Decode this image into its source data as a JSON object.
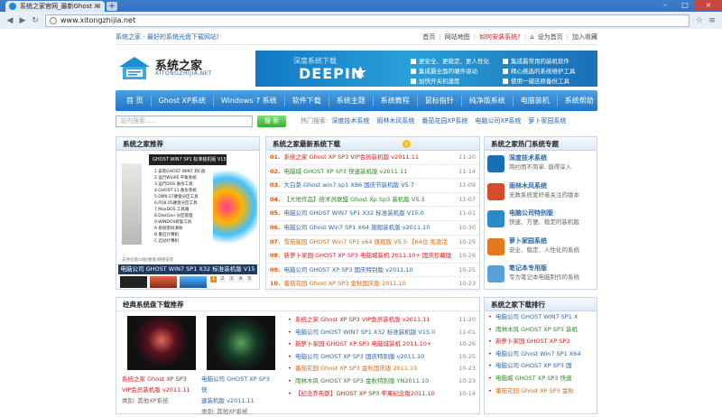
{
  "browser": {
    "tab_title": "系统之家官网_最新Ghost XI",
    "tab_close": "×",
    "new_tab": "+",
    "url": "www.xitongzhijia.net",
    "win_min": "–",
    "win_max": "□",
    "win_close": "×",
    "back": "◀",
    "forward": "▶",
    "reload": "↻",
    "star": "☆",
    "menu": "≡"
  },
  "topline": {
    "slogan": "系统之家 - 最好的系统光盘下载网站!",
    "links": [
      {
        "label": "首页",
        "hot": false
      },
      {
        "label": "网站地图",
        "hot": false
      },
      {
        "label": "如何安装系统?",
        "hot": true
      },
      {
        "label": "设为首页",
        "hot": false
      },
      {
        "label": "加入收藏",
        "hot": false
      }
    ]
  },
  "logo": {
    "title": "系统之家",
    "sub": "XITONGZHIJIA.NET"
  },
  "banner": {
    "line1": "深度系统下载",
    "brand": "DEEPIN",
    "features": [
      "更安全、更稳定、更人性化",
      "集成最常用的装机软件",
      "集成最全面的硬件驱动",
      "精心挑选的系统维护工具",
      "加快开关机速度",
      "使用一键还原备份工具"
    ]
  },
  "menu": [
    "首 页",
    "Ghost XP系统",
    "Windows 7 系统",
    "软件下载",
    "系统主题",
    "系统教程",
    "鼠标指针",
    "纯净版系统",
    "电脑装机",
    "系统帮助"
  ],
  "search": {
    "placeholder": "站内搜索......",
    "button": "搜 索",
    "hot_label": "热门搜索:",
    "hot_keys": [
      "深度技术系统",
      "雨林木风系统",
      "番茄花园XP系统",
      "电脑公司XP系统",
      "萝卜家园系统"
    ]
  },
  "recommend": {
    "title": "系统之家推荐",
    "dvd_label": "GHOST WIN7 SP1 标准装机版 V15",
    "menu_items": [
      "1.安装GHOST WIN7 到C盘",
      "2.运行WinPE 平板系统",
      "3.运行DOS 备份工具",
      "4.GHOST 11 备份系统",
      "5.DM9.57硬盘分区工具",
      "6.PQ8.05硬盘分区工具",
      "7.MaxDOS 工具箱",
      "8.DiskGen 分区管理",
      "9.WINDOS修复工具",
      "A.系统密码清除",
      "B.重启计算机",
      "C.启动计算机"
    ],
    "caption": "支持光盘/U盘/硬盘/网络安装",
    "footer_title": "电脑公司 GHOST WIN7 SP1 X32 标准装机版 V15",
    "pages": [
      "1",
      "2",
      "3",
      "4",
      "5"
    ],
    "thumb_colors": [
      "#222222",
      "#c44d2a",
      "#3a8ad0",
      "#2a9a5e",
      "#e6c23a"
    ]
  },
  "downloads": {
    "title": "系统之家最新系统下载",
    "items": [
      {
        "num": "01.",
        "title": "系统之家 Ghost XP SP3 VIP会员装机版 v2011.11",
        "date": "11-20",
        "color": "red"
      },
      {
        "num": "02.",
        "title": "电脑城 GHOST XP SP3 快速装机版 v2011.11",
        "date": "11-14",
        "color": "green"
      },
      {
        "num": "03.",
        "title": "大白菜 Ghost win7 sp1 X86 国庆节装机版 V5.7",
        "date": "11-09",
        "color": "blue"
      },
      {
        "num": "04.",
        "title": "【大地作品】技术员联盟 Ghost Xp Sp3 装机版 V5.3",
        "date": "11-07",
        "color": "green"
      },
      {
        "num": "05.",
        "title": "电脑公司 GHOST WIN7 SP1 X32 标准装机版 V15.0",
        "date": "11-01",
        "color": "blue"
      },
      {
        "num": "06.",
        "title": "电脑公司 Ghost Win7 SP1 X64 旗舰装机版 v2011.10",
        "date": "10-30",
        "color": "blue"
      },
      {
        "num": "07.",
        "title": "雪茄家园 GHOST Win7 SP1 x64 旗舰版 V5.5 【64位 免激活",
        "date": "10-29",
        "color": "orange"
      },
      {
        "num": "08.",
        "title": "新萝卜家园 GHOST XP SP3 电脑城装机 2011.10+ 国庆珍藏版",
        "date": "10-26",
        "color": "red"
      },
      {
        "num": "09.",
        "title": "电脑公司 GHOST XP SP3 国庆特别版 v2011.10",
        "date": "10-25",
        "color": "blue"
      },
      {
        "num": "10.",
        "title": "番茄花园 Ghost XP SP3 金秋国庆版 2011.10",
        "date": "10-23",
        "color": "orange"
      }
    ]
  },
  "hot_topics": {
    "title": "系统之家热门系统专题",
    "items": [
      {
        "title": "深度技术系统",
        "desc": "简约而不简单, 值得深入",
        "color": "#1a6fb3"
      },
      {
        "title": "雨林木风系统",
        "desc": "无数系统爱好者关注的版本",
        "color": "#d94a2a"
      },
      {
        "title": "电脑公司特别版",
        "desc": "快速、方便、稳定的装机版",
        "color": "#2a8acb"
      },
      {
        "title": "萝卜家园系统",
        "desc": "安全、稳定、人性化的系统",
        "color": "#e47a1e"
      },
      {
        "title": "笔记本专用版",
        "desc": "专为笔记本电脑制作的系统",
        "color": "#5aa0d8"
      }
    ]
  },
  "classic": {
    "title": "经典系统盘下载推荐",
    "cards": [
      {
        "line1": "系统之家 Ghost XP SP3",
        "line2": "VIP会员装机版 v2011.11",
        "line3": "类别: 其他XP系统",
        "red": true
      },
      {
        "line1": "电脑公司 GHOST XP SP3 快",
        "line2": "速装机版 v2011.11",
        "line3": "类别: 其他XP系统",
        "red": false
      }
    ],
    "items": [
      {
        "title": "系统之家 Ghost XP SP3 VIP会员装机版 v2011.11",
        "date": "11-20",
        "color": "red"
      },
      {
        "title": "电脑公司 GHOST WIN7 SP1 X32 标准装机版 V15.0",
        "date": "11-01",
        "color": "blue"
      },
      {
        "title": "新萝卜家园 GHOST XP SP3 电脑城装机 2011.10+",
        "date": "10-26",
        "color": "red"
      },
      {
        "title": "电脑公司 GHOST XP SP3 国庆特别版 v2011.10",
        "date": "10-25",
        "color": "blue"
      },
      {
        "title": "番茄花园 Ghost XP SP3 金秋国庆版 2011.10",
        "date": "10-23",
        "color": "orange"
      },
      {
        "title": "雨林木风 GHOST XP SP3 金秋特别版 YN2011.10",
        "date": "10-23",
        "color": "green"
      },
      {
        "title": "【纪念乔布斯】GHOST XP SP3 苹果纪念版2011.10",
        "date": "10-14",
        "color": "red"
      }
    ]
  },
  "rank": {
    "title": "系统之家下载排行",
    "items": [
      {
        "title": "电脑公司 GHOST WIN7 SP1 X",
        "color": "blue"
      },
      {
        "title": "雨林木风 GHOST XP SP3 装机",
        "color": "green"
      },
      {
        "title": "新萝卜家园 GHOST XP SP3",
        "color": "red"
      },
      {
        "title": "电脑公司 Ghost Win7 SP1 X64",
        "color": "blue"
      },
      {
        "title": "电脑公司 GHOST XP SP3 国",
        "color": "blue"
      },
      {
        "title": "电脑城 GHOST XP SP3 快速",
        "color": "green"
      },
      {
        "title": "番茄花园 Ghost XP SP3 金秋",
        "color": "orange"
      }
    ]
  }
}
